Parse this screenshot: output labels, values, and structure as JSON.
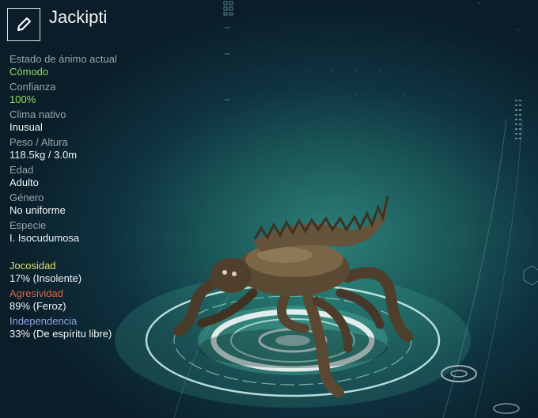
{
  "creature": {
    "name": "Jackipti"
  },
  "edit_icon": "pencil-icon",
  "stats": [
    {
      "label": "Estado de ánimo actual",
      "value": "Cómodo"
    },
    {
      "label": "Confianza",
      "value": "100%"
    },
    {
      "label": "Clima nativo",
      "value": "Inusual"
    },
    {
      "label": "Peso / Altura",
      "value": "118.5kg / 3.0m"
    },
    {
      "label": "Edad",
      "value": "Adulto"
    },
    {
      "label": "Género",
      "value": "No uniforme"
    },
    {
      "label": "Especie",
      "value": "I. Isocudumosa"
    }
  ],
  "traits": [
    {
      "label": "Jocosidad",
      "value": "17% (Insolente)",
      "color": "#dede6a"
    },
    {
      "label": "Agresividad",
      "value": "89% (Feroz)",
      "color": "#d9654a"
    },
    {
      "label": "Independencia",
      "value": "33% (De espíritu libre)",
      "color": "#8fa4e0"
    }
  ]
}
